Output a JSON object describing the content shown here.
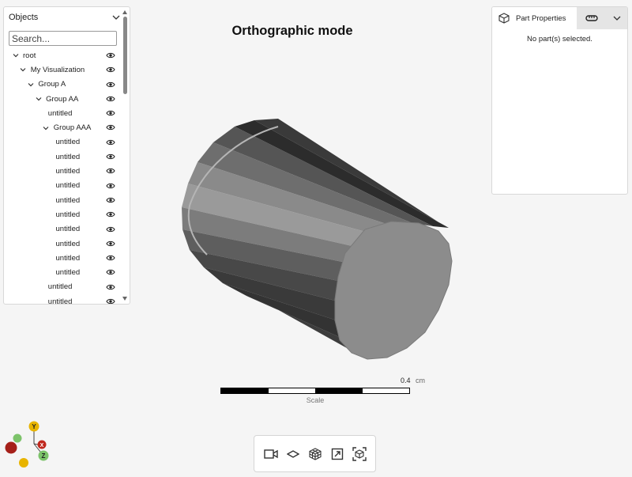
{
  "objects": {
    "title": "Objects",
    "search_placeholder": "Search...",
    "tree": [
      {
        "label": "root",
        "indent": 0,
        "expandable": true
      },
      {
        "label": "My Visualization",
        "indent": 1,
        "expandable": true
      },
      {
        "label": "Group A",
        "indent": 2,
        "expandable": true
      },
      {
        "label": "Group AA",
        "indent": 3,
        "expandable": true
      },
      {
        "label": "untitled",
        "indent": 4,
        "expandable": false
      },
      {
        "label": "Group AAA",
        "indent": 4,
        "expandable": true
      },
      {
        "label": "untitled",
        "indent": 5,
        "expandable": false
      },
      {
        "label": "untitled",
        "indent": 5,
        "expandable": false
      },
      {
        "label": "untitled",
        "indent": 5,
        "expandable": false
      },
      {
        "label": "untitled",
        "indent": 5,
        "expandable": false
      },
      {
        "label": "untitled",
        "indent": 5,
        "expandable": false
      },
      {
        "label": "untitled",
        "indent": 5,
        "expandable": false
      },
      {
        "label": "untitled",
        "indent": 5,
        "expandable": false
      },
      {
        "label": "untitled",
        "indent": 5,
        "expandable": false
      },
      {
        "label": "untitled",
        "indent": 5,
        "expandable": false
      },
      {
        "label": "untitled",
        "indent": 5,
        "expandable": false
      },
      {
        "label": "untitled",
        "indent": 4,
        "expandable": false
      },
      {
        "label": "untitled",
        "indent": 4,
        "expandable": false
      }
    ]
  },
  "viewport": {
    "title": "Orthographic mode"
  },
  "properties": {
    "tab_label": "Part Properties",
    "empty_message": "No part(s) selected."
  },
  "scale": {
    "value": "0.4",
    "unit": "cm",
    "label": "Scale"
  },
  "toolbar": {
    "tools": [
      "camera-icon",
      "plane-icon",
      "explode-icon",
      "fit-view-icon",
      "bounding-box-icon"
    ]
  },
  "axes": {
    "y_label": "Y",
    "x_label": "X",
    "z_label": "Z",
    "colors": {
      "y": "#e8b400",
      "x": "#c0281e",
      "z": "#7cc36a",
      "y_neg": "#e8b400",
      "x_neg": "#a52019",
      "z_neg": "#7cc36a"
    }
  },
  "colors": {
    "panel_bg": "#ffffff",
    "page_bg": "#f5f5f5",
    "tab_inactive_bg": "#e5e5e5"
  }
}
